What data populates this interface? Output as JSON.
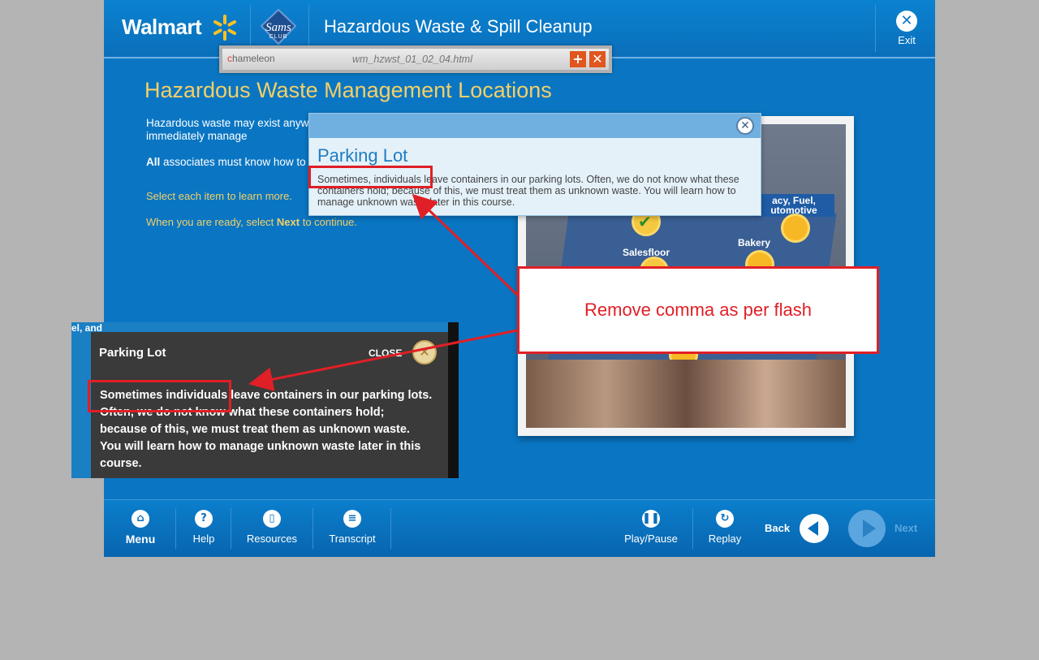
{
  "header": {
    "walmart": "Walmart",
    "sams": "Sams",
    "sams_sub": "CLUB",
    "course_title": "Hazardous Waste & Spill Cleanup",
    "exit_label": "Exit"
  },
  "chameleon": {
    "logo_first": "c",
    "logo_rest": "hameleon",
    "file": "wm_hzwst_01_02_04.html"
  },
  "main": {
    "heading": "Hazardous Waste Management Locations",
    "intro_1": "Hazardous waste may exist anyw it must be immediately manage",
    "intro_2_bold": "All",
    "intro_2_rest": " associates must know how to waste.",
    "select_each": "Select each item to learn more.",
    "ready_prefix": "When you are ready, select ",
    "ready_next": "Next",
    "ready_suffix": " to continue."
  },
  "scene": {
    "labels": {
      "auto": "acy, Fuel, utomotive",
      "bakery": "Bakery",
      "salesfloor": "Salesfloor"
    }
  },
  "popup": {
    "title": "Parking Lot",
    "body": "Sometimes, individuals leave containers in our parking lots.  Often, we do not know what these containers hold; because of this, we must treat them as unknown waste.  You will learn how to manage unknown waste later in this course."
  },
  "flash_reference": {
    "top_text": "el, and",
    "title": "Parking Lot",
    "close": "CLOSE",
    "body": "Sometimes individuals leave containers in our parking lots. Often, we do not know what these containers hold; because of this, we must treat them as unknown waste.  You will learn how to manage unknown waste later in this course."
  },
  "annotation": {
    "callout": "Remove comma as per flash",
    "color": "#e01f26"
  },
  "nav": {
    "menu": "Menu",
    "help": "Help",
    "resources": "Resources",
    "transcript": "Transcript",
    "play_pause": "Play/Pause",
    "replay": "Replay",
    "back": "Back",
    "next": "Next"
  },
  "colors": {
    "course_blue": "#0a76c3",
    "heading_yellow": "#f4cf66",
    "popup_title_blue": "#1e7cc2"
  }
}
